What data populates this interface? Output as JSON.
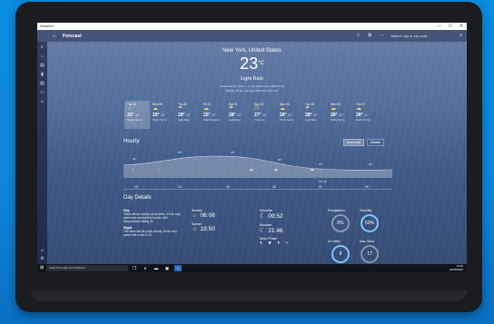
{
  "window": {
    "title": "Weather",
    "min": "─",
    "max": "☐",
    "close": "✕"
  },
  "appbar": {
    "back": "←",
    "title": "Forecast",
    "favorite": "☆",
    "pin": "⊞",
    "more": "···",
    "search_placeholder": "Search city or zip code",
    "search_icon": "⌕"
  },
  "sidebar": [
    "≡",
    "⌂",
    "▤",
    "▮",
    "▤",
    "▭",
    "☺",
    "☺",
    "⚙"
  ],
  "current": {
    "city": "New York, United States",
    "temp": "23",
    "unit": "°C",
    "condition": "Light Rain",
    "meta1": "Feels Like 23°   Wind ↗ 4 mph   Barometer 1008.00 mb",
    "meta2": "Visibility 16 km   Humidity 85%   Dew Point 12°"
  },
  "days": [
    {
      "name": "Tue 18",
      "icon": "☼",
      "hi": "31°",
      "lo": "24°",
      "cond": "Mostly Sunny"
    },
    {
      "name": "Wed 19",
      "icon": "☁",
      "hi": "29°",
      "lo": "24°",
      "cond": "Partly Sunny"
    },
    {
      "name": "Thu 20",
      "icon": "☂",
      "hi": "28°",
      "lo": "20°",
      "cond": "Light Rain"
    },
    {
      "name": "Fri 21",
      "icon": "☁",
      "hi": "25°",
      "lo": "21°",
      "cond": "Rain Showers"
    },
    {
      "name": "Sat 22",
      "icon": "☂",
      "hi": "28°",
      "lo": "22°",
      "cond": "Light Rain"
    },
    {
      "name": "Sun 23",
      "icon": "☈",
      "hi": "27°",
      "lo": "21°",
      "cond": "T-Storms"
    },
    {
      "name": "Mon 24",
      "icon": "☁",
      "hi": "28°",
      "lo": "20°",
      "cond": "Partly Sunny"
    },
    {
      "name": "Tue 25",
      "icon": "☂",
      "hi": "28°",
      "lo": "21°",
      "cond": "Light Rain"
    },
    {
      "name": "Wed 26",
      "icon": "☁",
      "hi": "28°",
      "lo": "20°",
      "cond": "Partly Sunny"
    },
    {
      "name": "Thu 27",
      "icon": "☁",
      "hi": "28°",
      "lo": "21°",
      "cond": "Partly Sunny"
    }
  ],
  "hourly": {
    "title": "Hourly",
    "summary_btn": "Summary",
    "details_btn": "Details",
    "temps": [
      "22°",
      "26°",
      "26°",
      "22°",
      "20°",
      "20°"
    ],
    "times": [
      "10",
      "12",
      "15",
      "18",
      "21",
      "00"
    ],
    "wind_label": "14mph"
  },
  "details": {
    "title": "Day Details",
    "day_h": "Day",
    "day_t": "There will be mostly sunny skies. It'll be very warm and comfortable humid, with temperatures hitting 31.",
    "night_h": "Night",
    "night_t": "The skies will be partly cloudy. It'll be very warm with a low of 24.",
    "sunrise_h": "Sunrise",
    "sunrise": "06:08",
    "sunset_h": "Sunset",
    "sunset": "19:50",
    "moonrise_h": "Moonrise",
    "moonrise": "09:52",
    "moonset_h": "Moonset",
    "moonset": "21:46",
    "moonphase_h": "Moon Phase",
    "precip_h": "Precipitation",
    "precip": "0%",
    "humid_h": "Humidity",
    "humid": "52%",
    "uv_h": "UV Index",
    "uv": "8",
    "wind_h": "Max. Wind",
    "wind": "17"
  },
  "taskbar": {
    "start": "⊞",
    "search": "Search the web and Windows",
    "time": "13:45",
    "date": "18/08/2015"
  }
}
